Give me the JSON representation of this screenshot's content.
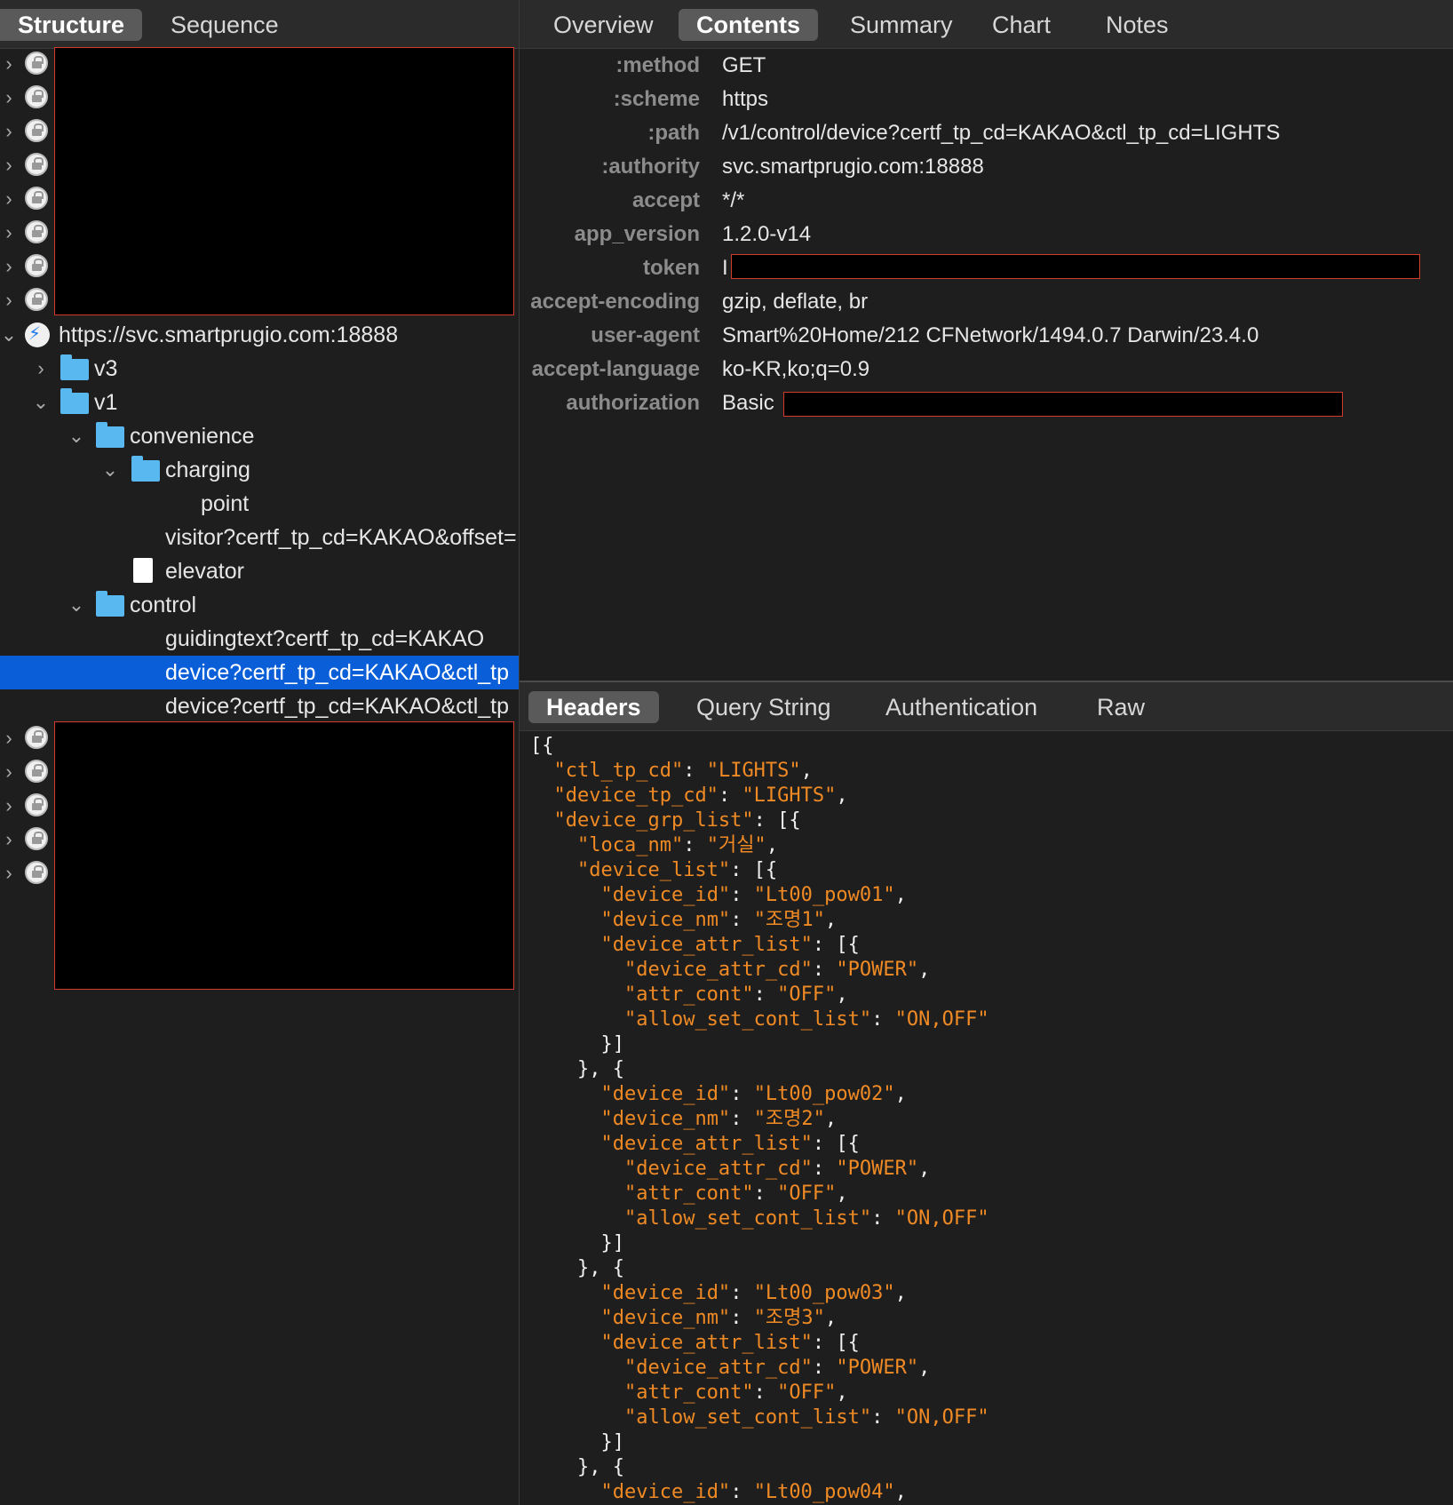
{
  "left_tabs": [
    "Structure",
    "Sequence"
  ],
  "left_active_tab": "Structure",
  "tree": {
    "host": "https://svc.smartprugio.com:18888",
    "v3": "v3",
    "v1": "v1",
    "convenience": "convenience",
    "charging": "charging",
    "point": "point",
    "visitor": "visitor?certf_tp_cd=KAKAO&offset=",
    "elevator": "elevator",
    "control": "control",
    "guidingtext": "guidingtext?certf_tp_cd=KAKAO",
    "device_selected": "device?certf_tp_cd=KAKAO&ctl_tp",
    "device_other": "device?certf_tp_cd=KAKAO&ctl_tp"
  },
  "right_tabs": [
    "Overview",
    "Contents",
    "Summary",
    "Chart",
    "Notes"
  ],
  "right_active_tab": "Contents",
  "headers": [
    {
      "key": ":method",
      "value": "GET"
    },
    {
      "key": ":scheme",
      "value": "https"
    },
    {
      "key": ":path",
      "value": "/v1/control/device?certf_tp_cd=KAKAO&ctl_tp_cd=LIGHTS"
    },
    {
      "key": ":authority",
      "value": "svc.smartprugio.com:18888"
    },
    {
      "key": "accept",
      "value": "*/*"
    },
    {
      "key": "app_version",
      "value": "1.2.0-v14"
    },
    {
      "key": "token",
      "value": "I"
    },
    {
      "key": "accept-encoding",
      "value": "gzip, deflate, br"
    },
    {
      "key": "user-agent",
      "value": "Smart%20Home/212 CFNetwork/1494.0.7 Darwin/23.4.0"
    },
    {
      "key": "accept-language",
      "value": "ko-KR,ko;q=0.9"
    },
    {
      "key": "authorization",
      "value": "Basic"
    }
  ],
  "bottom_tabs": [
    "Headers",
    "Query String",
    "Authentication",
    "Raw"
  ],
  "bottom_active_tab": "Headers",
  "json_lines": [
    "[{",
    "  \"ctl_tp_cd\": \"LIGHTS\",",
    "  \"device_tp_cd\": \"LIGHTS\",",
    "  \"device_grp_list\": [{",
    "    \"loca_nm\": \"거실\",",
    "    \"device_list\": [{",
    "      \"device_id\": \"Lt00_pow01\",",
    "      \"device_nm\": \"조명1\",",
    "      \"device_attr_list\": [{",
    "        \"device_attr_cd\": \"POWER\",",
    "        \"attr_cont\": \"OFF\",",
    "        \"allow_set_cont_list\": \"ON,OFF\"",
    "      }]",
    "    }, {",
    "      \"device_id\": \"Lt00_pow02\",",
    "      \"device_nm\": \"조명2\",",
    "      \"device_attr_list\": [{",
    "        \"device_attr_cd\": \"POWER\",",
    "        \"attr_cont\": \"OFF\",",
    "        \"allow_set_cont_list\": \"ON,OFF\"",
    "      }]",
    "    }, {",
    "      \"device_id\": \"Lt00_pow03\",",
    "      \"device_nm\": \"조명3\",",
    "      \"device_attr_list\": [{",
    "        \"device_attr_cd\": \"POWER\",",
    "        \"attr_cont\": \"OFF\",",
    "        \"allow_set_cont_list\": \"ON,OFF\"",
    "      }]",
    "    }, {",
    "      \"device_id\": \"Lt00_pow04\","
  ],
  "colors": {
    "selection": "#0a5fd8",
    "json_key": "#f08a24",
    "redaction_border": "#d23a2e"
  }
}
